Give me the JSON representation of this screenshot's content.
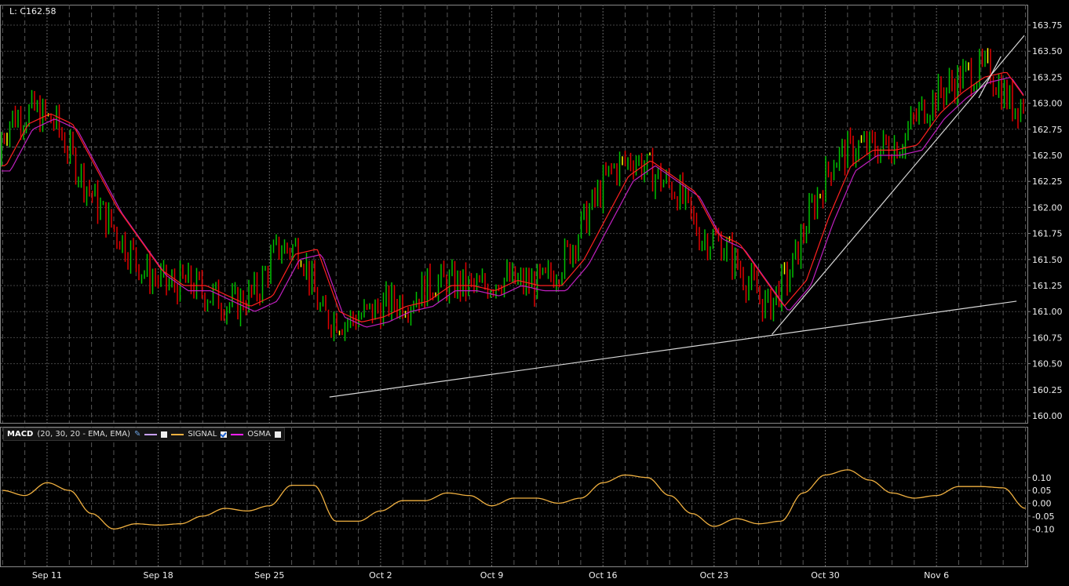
{
  "header": {
    "last_label": "L: C162.58"
  },
  "legend": {
    "name": "MACD",
    "params": "(20, 30, 20 - EMA, EMA)",
    "signal": "SIGNAL",
    "osma": "OSMA"
  },
  "colors": {
    "up": "#00c000",
    "down": "#e00000",
    "doji": "#ffff00",
    "ema_fast": "#ff2020",
    "ema_slow": "#c020c0",
    "signal": "#f0b040",
    "macd": "#c8a0ff",
    "osma": "#ff20ff",
    "trend": "#d8d8d8",
    "grid": "#555555"
  },
  "chart_data": [
    {
      "type": "candlestick",
      "title": "Price",
      "last_price": 162.58,
      "ylim": [
        159.9,
        163.9
      ],
      "yticks": [
        "160.00",
        "160.25",
        "160.50",
        "160.75",
        "161.00",
        "161.25",
        "161.50",
        "161.75",
        "162.00",
        "162.25",
        "162.50",
        "162.75",
        "163.00",
        "163.25",
        "163.50",
        "163.75"
      ],
      "xticks": [
        {
          "label": "Sep 11",
          "day": 2
        },
        {
          "label": "Sep 18",
          "day": 7
        },
        {
          "label": "Sep 25",
          "day": 12
        },
        {
          "label": "Oct 2",
          "day": 17
        },
        {
          "label": "Oct 9",
          "day": 22
        },
        {
          "label": "Oct 16",
          "day": 27
        },
        {
          "label": "Oct 23",
          "day": 32
        },
        {
          "label": "Oct 30",
          "day": 37
        },
        {
          "label": "Nov 6",
          "day": 42
        }
      ],
      "daily_ema": [
        162.4,
        162.8,
        162.9,
        162.8,
        162.4,
        162.0,
        161.7,
        161.4,
        161.25,
        161.25,
        161.15,
        161.05,
        161.15,
        161.55,
        161.6,
        161.0,
        160.9,
        160.95,
        161.05,
        161.1,
        161.25,
        161.25,
        161.2,
        161.3,
        161.25,
        161.25,
        161.5,
        161.9,
        162.3,
        162.45,
        162.3,
        162.15,
        161.75,
        161.65,
        161.35,
        161.05,
        161.3,
        161.9,
        162.4,
        162.55,
        162.55,
        162.6,
        162.9,
        163.1,
        163.25,
        163.3,
        163.0
      ],
      "trendlines": [
        {
          "from": [
            14.7,
            160.18
          ],
          "to": [
            45.6,
            161.1
          ]
        },
        {
          "from": [
            34.6,
            160.78
          ],
          "to": [
            45.95,
            163.65
          ]
        },
        {
          "from": [
            43.9,
            163.05
          ],
          "to": [
            44.9,
            163.45
          ]
        }
      ]
    },
    {
      "type": "line",
      "title": "MACD",
      "ylim": [
        -0.12,
        0.15
      ],
      "yticks": [
        "0.10",
        "0.05",
        "0.00",
        "-0.05",
        "-0.10"
      ],
      "series": [
        {
          "name": "SIGNAL",
          "values": [
            0.05,
            0.03,
            0.08,
            0.05,
            -0.04,
            -0.1,
            -0.08,
            -0.085,
            -0.08,
            -0.05,
            -0.02,
            -0.03,
            -0.01,
            0.07,
            0.07,
            -0.07,
            -0.07,
            -0.03,
            0.01,
            0.01,
            0.04,
            0.03,
            -0.01,
            0.02,
            0.02,
            0.0,
            0.02,
            0.08,
            0.11,
            0.1,
            0.03,
            -0.04,
            -0.09,
            -0.06,
            -0.08,
            -0.07,
            0.04,
            0.11,
            0.13,
            0.09,
            0.04,
            0.02,
            0.03,
            0.065,
            0.065,
            0.06,
            -0.02
          ]
        }
      ]
    }
  ]
}
